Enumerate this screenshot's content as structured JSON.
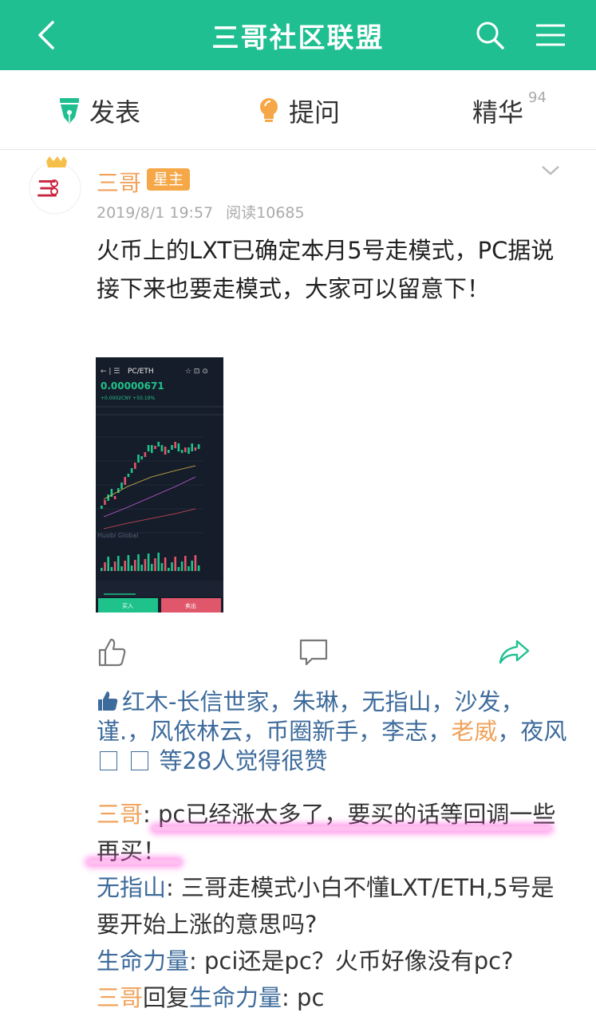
{
  "header": {
    "title": "三哥社区联盟",
    "accent_color": "#1fbf91"
  },
  "tabs": [
    {
      "label": "发表",
      "icon": "pen-icon"
    },
    {
      "label": "提问",
      "icon": "bulb-icon"
    },
    {
      "label": "精华",
      "count": "94"
    }
  ],
  "post": {
    "author": "三哥",
    "badge": "星主",
    "date": "2019/8/1 19:57",
    "reads": "阅读10685",
    "content": "火币上的LXT已确定本月5号走模式，PC据说接下来也要走模式，大家可以留意下！",
    "screenshot": {
      "pair": "PC/ETH",
      "price": "0.00000671",
      "change": "+0.0002CNY +50.19%",
      "watermark": "Huobi Global",
      "buy": "买入",
      "sell": "卖出"
    }
  },
  "likes": {
    "names": [
      "红木-长信世家",
      "朱琳",
      "无指山",
      "沙发",
      "谨.",
      "风依林云",
      "币圈新手",
      "李志",
      "老威",
      "夜风"
    ],
    "highlight": "老威",
    "suffix": "等28人觉得很赞"
  },
  "comments": [
    {
      "name": "三哥",
      "text": ": pc已经涨太多了，要买的话等回调一些再买！",
      "color": "orange"
    },
    {
      "name": "无指山",
      "text": ": 三哥走模式小白不懂LXT/ETH,5号是要开始上涨的意思吗?",
      "color": "blue"
    },
    {
      "name": "生命力量",
      "text": ": pci还是pc？火币好像没有pc?",
      "color": "blue"
    },
    {
      "name": "三哥",
      "reply_word": "回复",
      "reply_to": "生命力量",
      "text": ": pc",
      "color": "orange"
    }
  ]
}
